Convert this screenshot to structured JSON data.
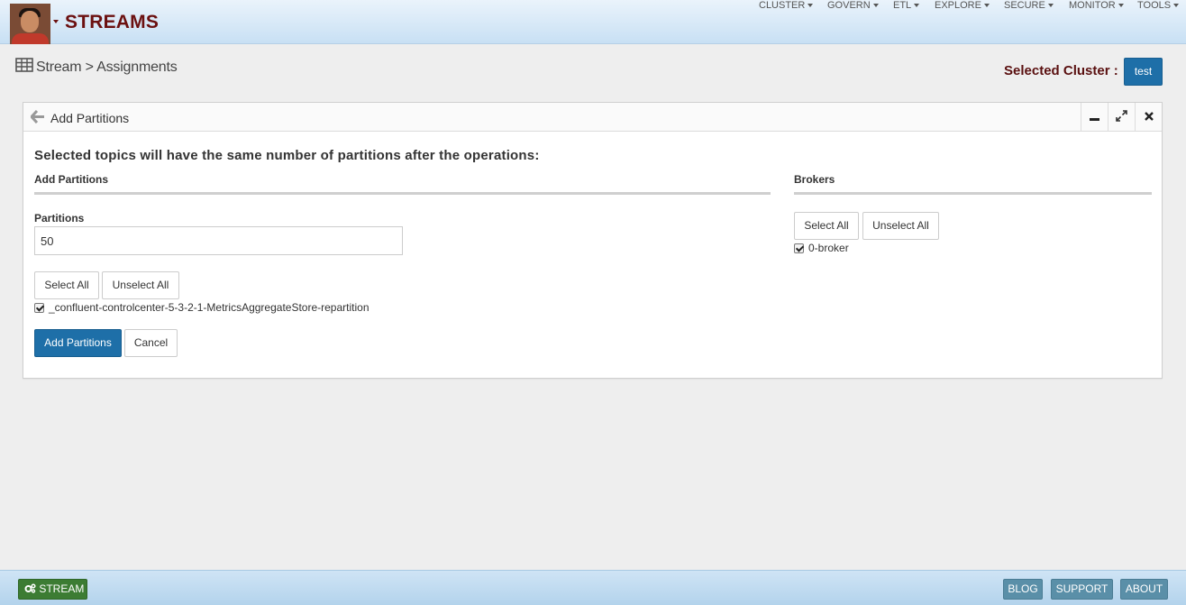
{
  "app": {
    "brand": "STREAMS"
  },
  "nav": {
    "items": [
      "CLUSTER",
      "GOVERN",
      "ETL",
      "EXPLORE",
      "SECURE",
      "MONITOR",
      "TOOLS"
    ]
  },
  "breadcrumb": {
    "text": "Stream > Assignments",
    "icon": "table-icon"
  },
  "cluster": {
    "label": "Selected Cluster :",
    "value": "test"
  },
  "panel": {
    "title": "Add Partitions",
    "heading": "Selected topics will have the same number of partitions after the operations:",
    "left": {
      "section_title": "Add Partitions",
      "field_label": "Partitions",
      "field_value": "50",
      "select_all": "Select All",
      "unselect_all": "Unselect All",
      "topic": "_confluent-controlcenter-5-3-2-1-MetricsAggregateStore-repartition",
      "topic_checked": true,
      "submit": "Add Partitions",
      "cancel": "Cancel"
    },
    "right": {
      "section_title": "Brokers",
      "select_all": "Select All",
      "unselect_all": "Unselect All",
      "broker": "0-broker",
      "broker_checked": true
    }
  },
  "footer": {
    "stream": "STREAM",
    "blog": "BLOG",
    "support": "SUPPORT",
    "about": "ABOUT"
  },
  "colors": {
    "brand": "#6b1010",
    "primary": "#1e6fa8",
    "stream_button": "#3c7c33",
    "footer_button": "#5a8fa8"
  }
}
